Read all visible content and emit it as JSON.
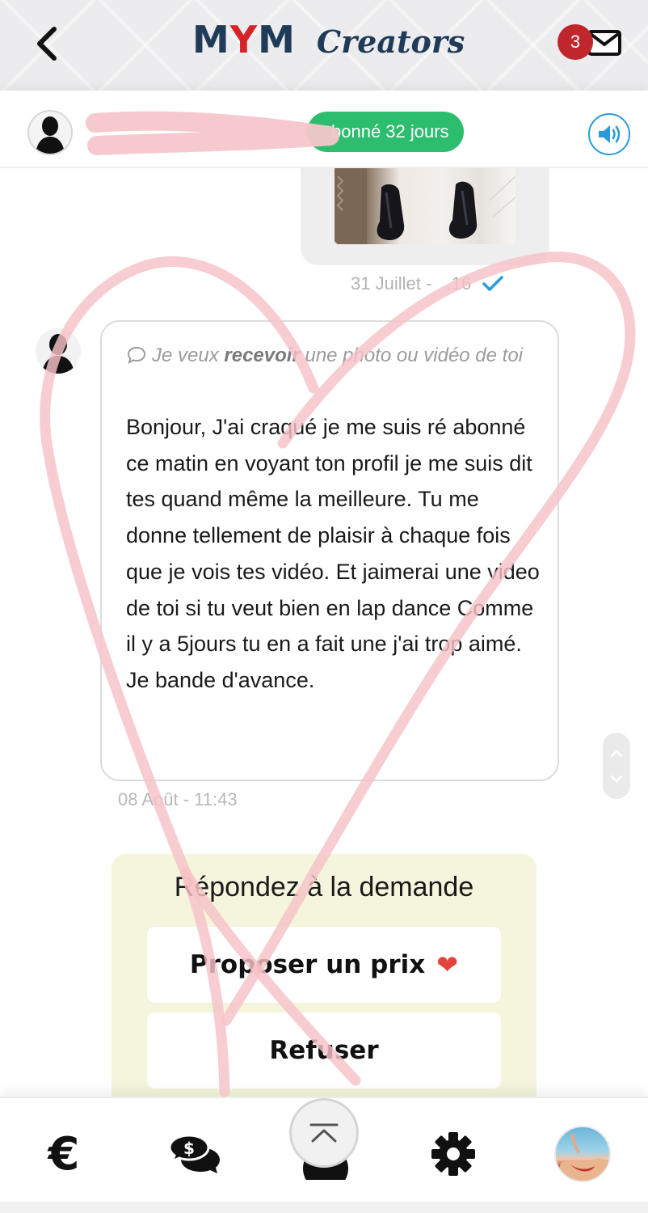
{
  "header": {
    "logo_mym_m1": "M",
    "logo_mym_y": "Y",
    "logo_mym_m2": "M",
    "logo_creators": "Creators",
    "notification_count": "3"
  },
  "subheader": {
    "subscription_badge": "bonné 32 jours"
  },
  "conversation": {
    "sent_time": "31 Juillet -   .16",
    "request_type_prefix": "Je veux ",
    "request_type_bold": "recevoir",
    "request_type_suffix": " une photo ou vidéo de toi",
    "message_text": "Bonjour, J'ai craqué je me suis ré abonné ce matin en voyant ton profil je me suis dit tes quand même la meilleure. Tu me donne tellement de plaisir à chaque fois que je vois tes vidéo. Et jaimerai une video de toi si tu veut bien en lap dance Comme il y a 5jours tu en a fait une j'ai trop aimé. Je bande d'avance.",
    "message_time": "08 Août - 11:43"
  },
  "request_panel": {
    "title": "Répondez à la demande",
    "propose_label": "Proposer un prix",
    "propose_icon": "❤",
    "refuse_label": "Refuser"
  },
  "bottom_nav": {
    "euro_icon": "€"
  },
  "colors": {
    "brand_navy": "#1f3b57",
    "brand_red": "#d6232a",
    "badge_green": "#2dbd6e",
    "accent_blue": "#2a9bd8",
    "panel_bg": "#f4f5dc",
    "doodle_pink": "#f7c9cd"
  },
  "icons": [
    "back-arrow-icon",
    "mail-icon",
    "user-silhouette-icon",
    "speaker-icon",
    "check-icon",
    "chat-bubble-icon",
    "chevron-up-icon",
    "chevron-down-icon",
    "euro-icon",
    "money-chat-icon",
    "gear-icon",
    "scroll-to-top-icon",
    "heart-icon"
  ]
}
